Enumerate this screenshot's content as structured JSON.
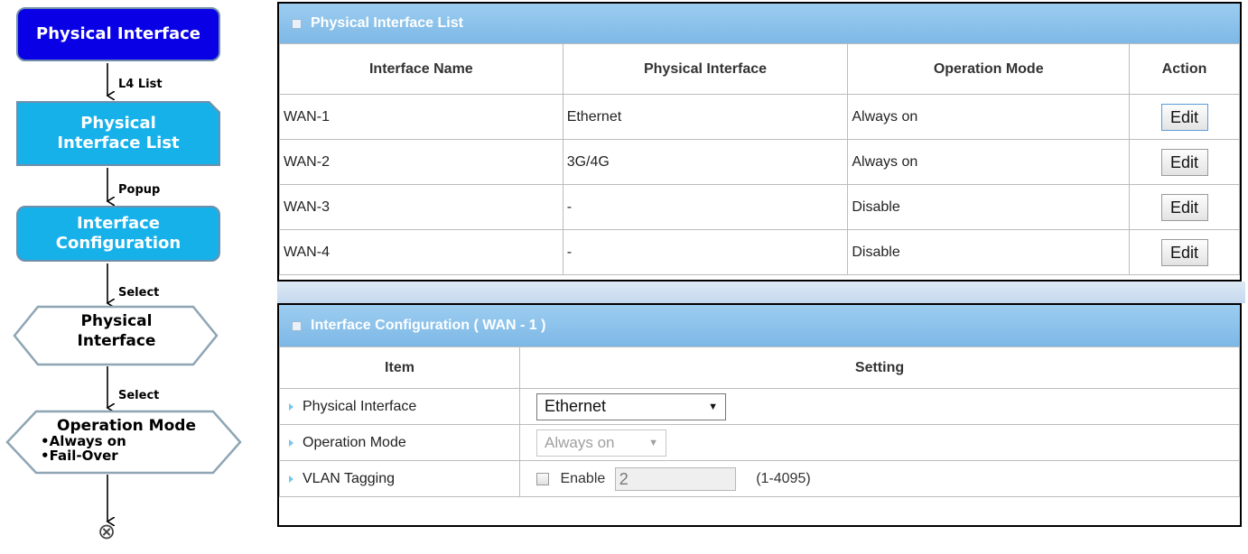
{
  "flow": {
    "node1": "Physical Interface",
    "arrow1": "L4 List",
    "node2_line1": "Physical",
    "node2_line2": "Interface List",
    "arrow2": "Popup",
    "node3_line1": "Interface",
    "node3_line2": "Configuration",
    "arrow3": "Select",
    "node4_line1": "Physical",
    "node4_line2": "Interface",
    "arrow4": "Select",
    "node5_title": "Operation Mode",
    "node5_item1": "•Always on",
    "node5_item2": "•Fail-Over",
    "end_symbol": "⊗"
  },
  "list_panel": {
    "title": "Physical Interface List",
    "columns": [
      "Interface Name",
      "Physical Interface",
      "Operation Mode",
      "Action"
    ],
    "rows": [
      {
        "name": "WAN-1",
        "physical": "Ethernet",
        "mode": "Always on",
        "action": "Edit"
      },
      {
        "name": "WAN-2",
        "physical": "3G/4G",
        "mode": "Always on",
        "action": "Edit"
      },
      {
        "name": "WAN-3",
        "physical": "-",
        "mode": "Disable",
        "action": "Edit"
      },
      {
        "name": "WAN-4",
        "physical": "-",
        "mode": "Disable",
        "action": "Edit"
      }
    ]
  },
  "config_panel": {
    "title": "Interface Configuration ( WAN - 1 )",
    "columns": [
      "Item",
      "Setting"
    ],
    "physical_interface": {
      "label": "Physical Interface",
      "value": "Ethernet"
    },
    "operation_mode": {
      "label": "Operation Mode",
      "value": "Always on"
    },
    "vlan": {
      "label": "VLAN Tagging",
      "enable_label": "Enable",
      "value": "2",
      "range": "(1-4095)",
      "checked": false
    }
  },
  "colors": {
    "node_dark": "#0a00e6",
    "node_light": "#17b1ea",
    "panel_header": "#86bfe9",
    "border": "#6f8faa"
  }
}
